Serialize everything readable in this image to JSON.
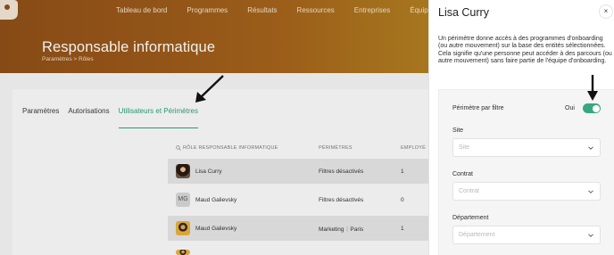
{
  "nav": {
    "items": [
      "Tableau de bord",
      "Programmes",
      "Résultats",
      "Ressources",
      "Entreprises",
      "Équipe"
    ]
  },
  "hero": {
    "title": "Responsable informatique",
    "breadcrumb": "Paramètres > Rôles"
  },
  "tabs": [
    "Paramètres",
    "Autorisations",
    "Utilisateurs et Périmètres"
  ],
  "table": {
    "headers": [
      "RÔLE RESPONSABLE INFORMATIQUE",
      "PÉRIMÈTRES",
      "EMPLOYÉ"
    ],
    "rows": [
      {
        "name": "Lisa Curry",
        "scope": "Filtres désactivés",
        "count": "1",
        "avatar": "photo"
      },
      {
        "name": "Maud Galievsky",
        "scope": "Filtres désactivés",
        "count": "0",
        "avatar": "MG"
      },
      {
        "name": "Maud Galievsky",
        "scope": "Marketing",
        "scope2": "Paris",
        "count": "1",
        "avatar": "photo"
      }
    ]
  },
  "panel": {
    "title": "Lisa Curry",
    "close_icon": "×",
    "description": "Un périmètre donne accès à des programmes d'onboarding (ou autre mouvement) sur la base des entités sélectionnées. Cela signifie qu'une personne peut accéder à des parcours (ou autre mouvement) sans faire partie de l'équipe d'onboarding.",
    "scope_filter_label": "Périmètre par filtre",
    "toggle_value_label": "Oui",
    "toggle_on": true,
    "fields": [
      {
        "label": "Site",
        "placeholder": "Site"
      },
      {
        "label": "Contrat",
        "placeholder": "Contrat"
      },
      {
        "label": "Département",
        "placeholder": "Département"
      }
    ]
  },
  "colors": {
    "accent": "#2aa17e",
    "toggle": "#37a882",
    "hero_start": "#8f4f18",
    "hero_end": "#c9a733"
  }
}
